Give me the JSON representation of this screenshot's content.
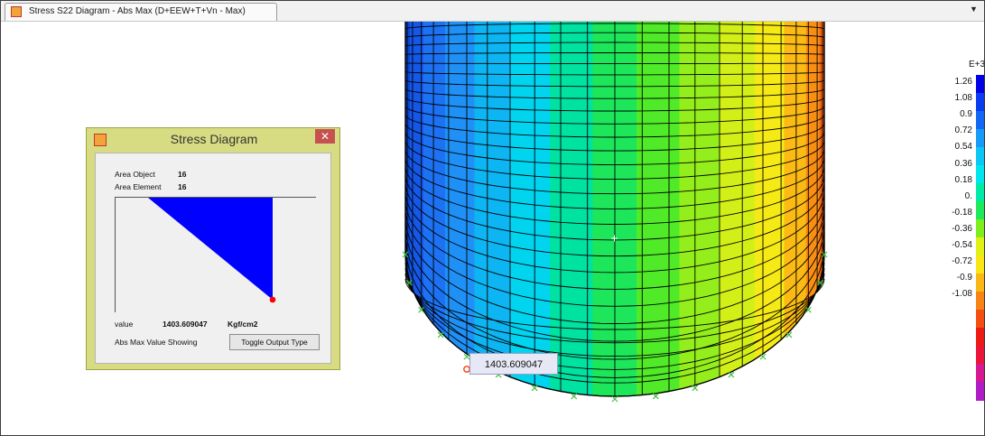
{
  "window": {
    "tab_title": "Stress S22 Diagram - Abs Max  (D+EEW+T+Vn - Max)",
    "tab_icon": "sap2000-logo-icon",
    "dropdown_icon": "chevron-down-icon",
    "dropdown_glyph": "▼"
  },
  "model": {
    "band_colors": [
      "#0c46d6",
      "#1557e6",
      "#1c72f2",
      "#1f91f6",
      "#0db5f2",
      "#00d4ef",
      "#00e2a2",
      "#1ee65a",
      "#50ea28",
      "#93ee1b",
      "#d2f018",
      "#f6ea16",
      "#fbbb14",
      "#f98f12",
      "#f36416"
    ],
    "joint_color": "#40c040",
    "mesh_color": "#000000"
  },
  "dialog": {
    "title": "Stress Diagram",
    "close_glyph": "✕",
    "area_object_label": "Area Object",
    "area_object_value": "16",
    "area_element_label": "Area Element",
    "area_element_value": "16",
    "value_label": "value",
    "value": "1403.609047",
    "unit": "Kgf/cm2",
    "status": "Abs Max Value Showing",
    "toggle_label": "Toggle Output Type",
    "fill_color": "#0000ff",
    "marker_color": "#ff0000"
  },
  "tooltip": {
    "text": "1403.609047",
    "marker_color": "#ff3a00"
  },
  "legend": {
    "exponent": "E+3",
    "ticks": [
      "1.26",
      "1.08",
      "0.9",
      "0.72",
      "0.54",
      "0.36",
      "0.18",
      "0.",
      "-0.18",
      "-0.36",
      "-0.54",
      "-0.72",
      "-0.9",
      "-1.08"
    ],
    "colors": [
      "#0000e6",
      "#0a3bf0",
      "#1268f4",
      "#189af8",
      "#0cc6f6",
      "#00e6ee",
      "#00eba6",
      "#1ee95a",
      "#7fee1e",
      "#e1f014",
      "#f9e614",
      "#f9b814",
      "#f88214",
      "#f44e14",
      "#ee1a14",
      "#ec1438",
      "#d81890",
      "#b01cc8"
    ]
  }
}
